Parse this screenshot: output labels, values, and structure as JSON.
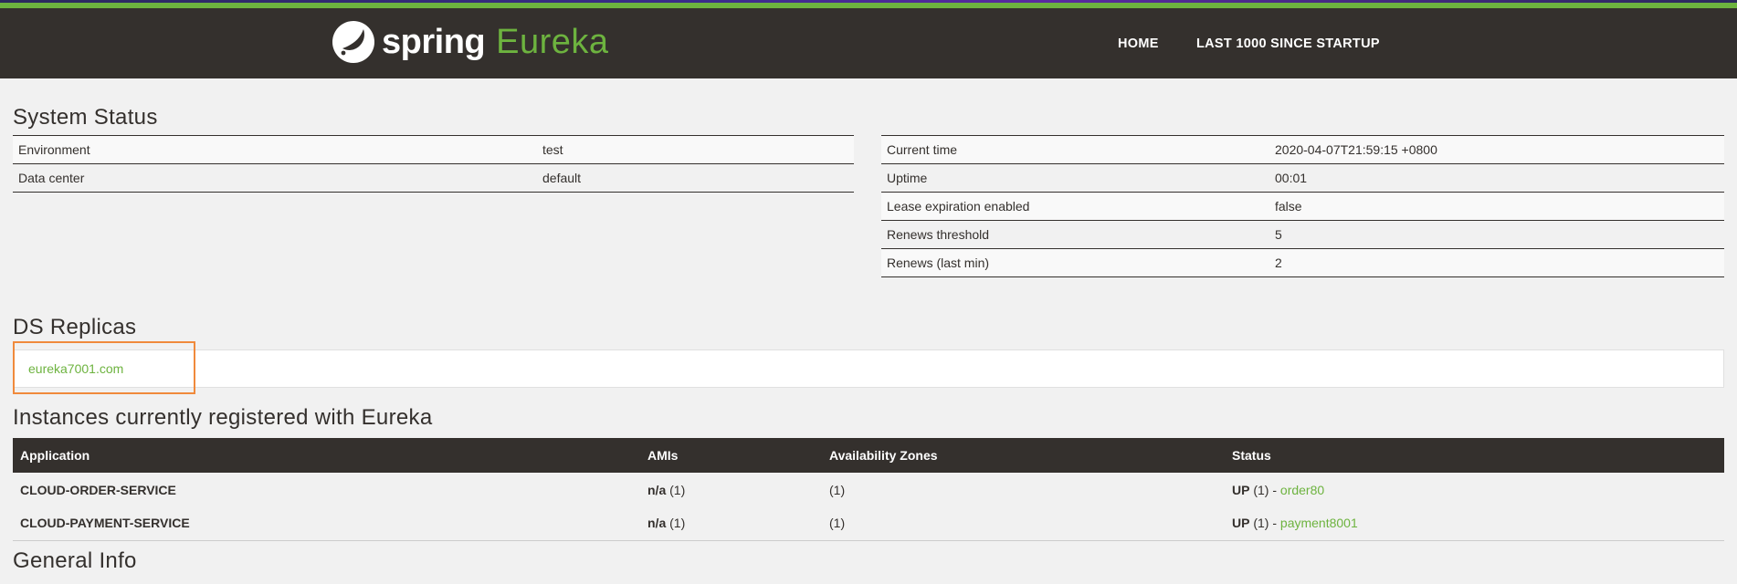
{
  "header": {
    "brand_spring": "spring",
    "brand_eureka": "Eureka",
    "nav": [
      {
        "label": "HOME"
      },
      {
        "label": "LAST 1000 SINCE STARTUP"
      }
    ]
  },
  "system_status": {
    "title": "System Status",
    "left": [
      {
        "label": "Environment",
        "value": "test"
      },
      {
        "label": "Data center",
        "value": "default"
      }
    ],
    "right": [
      {
        "label": "Current time",
        "value": "2020-04-07T21:59:15 +0800"
      },
      {
        "label": "Uptime",
        "value": "00:01"
      },
      {
        "label": "Lease expiration enabled",
        "value": "false"
      },
      {
        "label": "Renews threshold",
        "value": "5"
      },
      {
        "label": "Renews (last min)",
        "value": "2"
      }
    ]
  },
  "ds_replicas": {
    "title": "DS Replicas",
    "items": [
      {
        "label": "eureka7001.com"
      }
    ]
  },
  "instances": {
    "title": "Instances currently registered with Eureka",
    "columns": [
      "Application",
      "AMIs",
      "Availability Zones",
      "Status"
    ],
    "rows": [
      {
        "application": "CLOUD-ORDER-SERVICE",
        "amis_bold": "n/a",
        "amis_count": "(1)",
        "zones": "(1)",
        "status_bold": "UP",
        "status_count": "(1) - ",
        "status_link": "order80"
      },
      {
        "application": "CLOUD-PAYMENT-SERVICE",
        "amis_bold": "n/a",
        "amis_count": "(1)",
        "zones": "(1)",
        "status_bold": "UP",
        "status_count": "(1) - ",
        "status_link": "payment8001"
      }
    ]
  },
  "general_info": {
    "title": "General Info"
  },
  "colors": {
    "accent": "#6db33f",
    "dark": "#34302d",
    "highlight": "#f08a3c"
  }
}
